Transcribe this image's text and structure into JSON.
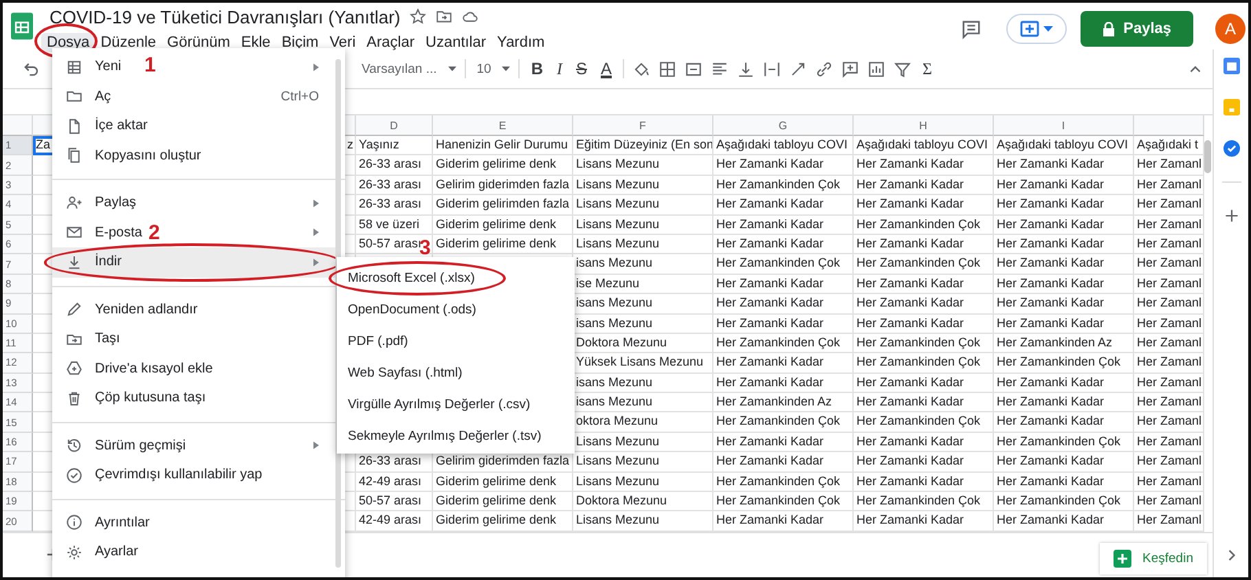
{
  "document": {
    "title": "COVID-19  ve Tüketici Davranışları (Yanıtlar)"
  },
  "menu_bar": [
    {
      "label": "Dosya",
      "selected": true,
      "circled": true
    },
    {
      "label": "Düzenle",
      "selected": false,
      "circled": false
    },
    {
      "label": "Görünüm",
      "selected": false,
      "circled": false
    },
    {
      "label": "Ekle",
      "selected": false,
      "circled": false
    },
    {
      "label": "Biçim",
      "selected": false,
      "circled": false
    },
    {
      "label": "Veri",
      "selected": false,
      "circled": false
    },
    {
      "label": "Araçlar",
      "selected": false,
      "circled": false
    },
    {
      "label": "Uzantılar",
      "selected": false,
      "circled": false
    },
    {
      "label": "Yardım",
      "selected": false,
      "circled": false
    }
  ],
  "header_actions": {
    "share_button": "Paylaş",
    "avatar": "A"
  },
  "toolbar": {
    "font": "Varsayılan ...",
    "font_size": "10",
    "format_buttons": [
      "B",
      "I",
      "S",
      "A"
    ],
    "function_button": "Σ"
  },
  "file_menu": [
    {
      "kind": "item",
      "label": "Yeni",
      "submenu": true,
      "highlighted": false,
      "circled": false
    },
    {
      "kind": "item",
      "label": "Aç",
      "shortcut": "Ctrl+O",
      "submenu": false,
      "highlighted": false,
      "circled": false
    },
    {
      "kind": "item",
      "label": "İçe aktar",
      "submenu": false,
      "highlighted": false,
      "circled": false
    },
    {
      "kind": "item",
      "label": "Kopyasını oluştur",
      "submenu": false,
      "highlighted": false,
      "circled": false
    },
    {
      "kind": "divider"
    },
    {
      "kind": "item",
      "label": "Paylaş",
      "submenu": true,
      "highlighted": false,
      "circled": false
    },
    {
      "kind": "item",
      "label": "E-posta",
      "submenu": true,
      "highlighted": false,
      "circled": false
    },
    {
      "kind": "item",
      "label": "İndir",
      "submenu": true,
      "highlighted": true,
      "circled": true
    },
    {
      "kind": "divider"
    },
    {
      "kind": "item",
      "label": "Yeniden adlandır",
      "submenu": false,
      "highlighted": false,
      "circled": false
    },
    {
      "kind": "item",
      "label": "Taşı",
      "submenu": false,
      "highlighted": false,
      "circled": false
    },
    {
      "kind": "item",
      "label": "Drive'a kısayol ekle",
      "submenu": false,
      "highlighted": false,
      "circled": false
    },
    {
      "kind": "item",
      "label": "Çöp kutusuna taşı",
      "submenu": false,
      "highlighted": false,
      "circled": false
    },
    {
      "kind": "divider"
    },
    {
      "kind": "item",
      "label": "Sürüm geçmişi",
      "submenu": true,
      "highlighted": false,
      "circled": false
    },
    {
      "kind": "item",
      "label": "Çevrimdışı kullanılabilir yap",
      "submenu": false,
      "highlighted": false,
      "circled": false
    },
    {
      "kind": "divider"
    },
    {
      "kind": "item",
      "label": "Ayrıntılar",
      "submenu": false,
      "highlighted": false,
      "circled": false
    },
    {
      "kind": "item",
      "label": "Ayarlar",
      "submenu": false,
      "highlighted": false,
      "circled": false
    }
  ],
  "download_submenu": [
    {
      "label": "Microsoft Excel (.xlsx)",
      "circled": true
    },
    {
      "label": "OpenDocument (.ods)",
      "circled": false
    },
    {
      "label": "PDF (.pdf)",
      "circled": false
    },
    {
      "label": "Web Sayfası (.html)",
      "circled": false
    },
    {
      "label": "Virgülle Ayrılmış Değerler (.csv)",
      "circled": false
    },
    {
      "label": "Sekmeyle Ayrılmış Değerler (.tsv)",
      "circled": false
    }
  ],
  "annotations": [
    {
      "number": "1"
    },
    {
      "number": "2"
    },
    {
      "number": "3"
    }
  ],
  "sheet": {
    "column_headers": {
      "d": "D",
      "e": "E",
      "f": "F",
      "g": "G",
      "h": "H",
      "i": "I"
    },
    "rows": [
      {
        "number": "1",
        "selected": true,
        "cells": {
          "a": "Za",
          "c": "z",
          "d": "Yaşınız",
          "e": "Hanenizin Gelir Durumu",
          "f": "Eğitim Düzeyiniz (En son",
          "g": "Aşağıdaki tabloyu COVI",
          "h": "Aşağıdaki tabloyu COVI",
          "i": "Aşağıdaki tabloyu COVI",
          "j": "Aşağıdaki t"
        }
      },
      {
        "number": "2",
        "selected": false,
        "cells": {
          "d": "26-33 arası",
          "e": "Giderim gelirime denk",
          "f": "Lisans Mezunu",
          "g": "Her Zamanki Kadar",
          "h": "Her Zamanki Kadar",
          "i": "Her Zamanki Kadar",
          "j": "Her Zamanl"
        }
      },
      {
        "number": "3",
        "selected": false,
        "cells": {
          "d": "26-33 arası",
          "e": "Gelirim giderimden fazla",
          "f": "Lisans Mezunu",
          "g": "Her Zamankinden Çok",
          "h": "Her Zamanki Kadar",
          "i": "Her Zamanki Kadar",
          "j": "Her Zamanl"
        }
      },
      {
        "number": "4",
        "selected": false,
        "cells": {
          "d": "26-33 arası",
          "e": "Giderim gelirimden fazla",
          "f": "Lisans Mezunu",
          "g": "Her Zamanki Kadar",
          "h": "Her Zamanki Kadar",
          "i": "Her Zamanki Kadar",
          "j": "Her Zamanl"
        }
      },
      {
        "number": "5",
        "selected": false,
        "cells": {
          "d": "58 ve üzeri",
          "e": "Giderim gelirime denk",
          "f": "Lisans Mezunu",
          "g": "Her Zamanki Kadar",
          "h": "Her Zamankinden Çok",
          "i": "Her Zamanki Kadar",
          "j": "Her Zamanl"
        }
      },
      {
        "number": "6",
        "selected": false,
        "cells": {
          "d": "50-57 arası",
          "e": "Giderim gelirime denk",
          "f": "Lisans Mezunu",
          "g": "Her Zamanki Kadar",
          "h": "Her Zamanki Kadar",
          "i": "Her Zamanki Kadar",
          "j": "Her Zamanl"
        }
      },
      {
        "number": "7",
        "selected": false,
        "cells": {
          "f": "isans Mezunu",
          "g": "Her Zamankinden Çok",
          "h": "Her Zamankinden Çok",
          "i": "Her Zamanki Kadar",
          "j": "Her Zamanl"
        }
      },
      {
        "number": "8",
        "selected": false,
        "cells": {
          "f": "ise Mezunu",
          "g": "Her Zamanki Kadar",
          "h": "Her Zamanki Kadar",
          "i": "Her Zamanki Kadar",
          "j": "Her Zamanl"
        }
      },
      {
        "number": "9",
        "selected": false,
        "cells": {
          "f": "isans Mezunu",
          "g": "Her Zamanki Kadar",
          "h": "Her Zamanki Kadar",
          "i": "Her Zamanki Kadar",
          "j": "Her Zamanl"
        }
      },
      {
        "number": "10",
        "selected": false,
        "cells": {
          "f": "isans Mezunu",
          "g": "Her Zamanki Kadar",
          "h": "Her Zamanki Kadar",
          "i": "Her Zamanki Kadar",
          "j": "Her Zamanl"
        }
      },
      {
        "number": "11",
        "selected": false,
        "cells": {
          "f": "Doktora Mezunu",
          "g": "Her Zamankinden Çok",
          "h": "Her Zamankinden Çok",
          "i": "Her Zamankinden Az",
          "j": "Her Zamanl"
        }
      },
      {
        "number": "12",
        "selected": false,
        "cells": {
          "f": "Yüksek Lisans Mezunu",
          "g": "Her Zamanki Kadar",
          "h": "Her Zamankinden Çok",
          "i": "Her Zamankinden Çok",
          "j": "Her Zamanl"
        }
      },
      {
        "number": "13",
        "selected": false,
        "cells": {
          "f": "isans Mezunu",
          "g": "Her Zamanki Kadar",
          "h": "Her Zamanki Kadar",
          "i": "Her Zamanki Kadar",
          "j": "Her Zamanl"
        }
      },
      {
        "number": "14",
        "selected": false,
        "cells": {
          "f": "isans Mezunu",
          "g": "Her Zamankinden Az",
          "h": "Her Zamanki Kadar",
          "i": "Her Zamanki Kadar",
          "j": "Her Zamanl"
        }
      },
      {
        "number": "15",
        "selected": false,
        "cells": {
          "f": "oktora Mezunu",
          "g": "Her Zamankinden Çok",
          "h": "Her Zamankinden Çok",
          "i": "Her Zamanki Kadar",
          "j": "Her Zamanl"
        }
      },
      {
        "number": "16",
        "selected": false,
        "cells": {
          "f": "Lisans Mezunu",
          "g": "Her Zamanki Kadar",
          "h": "Her Zamanki Kadar",
          "i": "Her Zamankinden Çok",
          "j": "Her Zamanl"
        }
      },
      {
        "number": "17",
        "selected": false,
        "cells": {
          "d": "26-33 arası",
          "e": "Gelirim giderimden fazla",
          "f": "Lisans Mezunu",
          "g": "Her Zamanki Kadar",
          "h": "Her Zamanki Kadar",
          "i": "Her Zamanki Kadar",
          "j": "Her Zamanl"
        }
      },
      {
        "number": "18",
        "selected": false,
        "cells": {
          "d": "42-49 arası",
          "e": "Giderim gelirime denk",
          "f": "Lisans Mezunu",
          "g": "Her Zamankinden Çok",
          "h": "Her Zamanki Kadar",
          "i": "Her Zamanki Kadar",
          "j": "Her Zamanl"
        }
      },
      {
        "number": "19",
        "selected": false,
        "cells": {
          "d": "50-57 arası",
          "e": "Giderim gelirime denk",
          "f": "Doktora Mezunu",
          "g": "Her Zamankinden Çok",
          "h": "Her Zamankinden Çok",
          "i": "Her Zamankinden Çok",
          "j": "Her Zamanl"
        }
      },
      {
        "number": "20",
        "selected": false,
        "cells": {
          "d": "42-49 arası",
          "e": "Giderim gelirime denk",
          "f": "Lisans Mezunu",
          "g": "Her Zamanki Kadar",
          "h": "Her Zamanki Kadar",
          "i": "Her Zamanki Kadar",
          "j": "Her Zamanl"
        }
      }
    ]
  },
  "explore_button": "Keşfedin"
}
